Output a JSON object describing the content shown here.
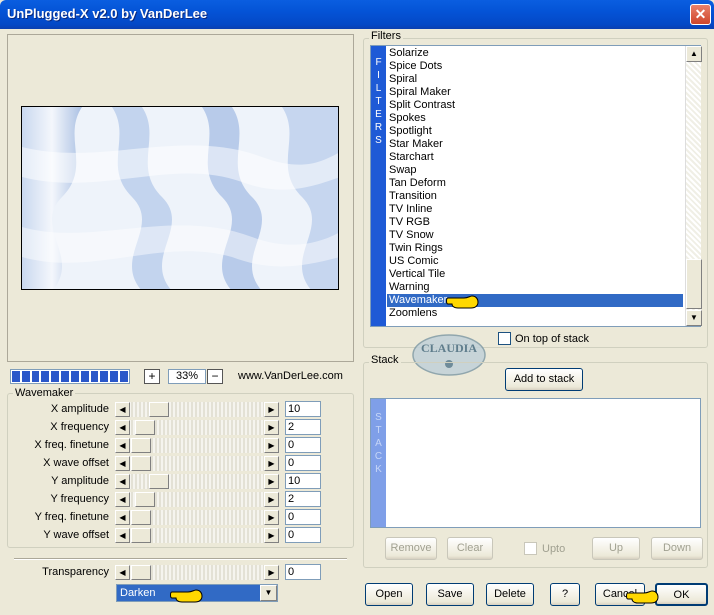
{
  "window": {
    "title": "UnPlugged-X v2.0 by VanDerLee",
    "close_icon": "close-icon"
  },
  "preview": {
    "zoom": "33%",
    "url": "www.VanDerLee.com",
    "progress_segments": 12,
    "plus": "+",
    "minus": "−"
  },
  "wavemaker": {
    "legend": "Wavemaker",
    "params": [
      {
        "label": "X amplitude",
        "value": "10",
        "level": 0.16
      },
      {
        "label": "X frequency",
        "value": "2",
        "level": 0.04
      },
      {
        "label": "X freq. finetune",
        "value": "0",
        "level": 0
      },
      {
        "label": "X wave offset",
        "value": "0",
        "level": 0
      },
      {
        "label": "Y amplitude",
        "value": "10",
        "level": 0.16
      },
      {
        "label": "Y frequency",
        "value": "2",
        "level": 0.04
      },
      {
        "label": "Y freq. finetune",
        "value": "0",
        "level": 0
      },
      {
        "label": "Y wave offset",
        "value": "0",
        "level": 0
      }
    ]
  },
  "transparency": {
    "label": "Transparency",
    "value": "0",
    "level": 0
  },
  "blend": {
    "selected": "Darken"
  },
  "filters": {
    "legend": "Filters",
    "strip": "FILTERS",
    "selected": "Wavemaker",
    "items": [
      "Solarize",
      "Spice Dots",
      "Spiral",
      "Spiral Maker",
      "Split Contrast",
      "Spokes",
      "Spotlight",
      "Star Maker",
      "Starchart",
      "Swap",
      "Tan Deform",
      "Transition",
      "TV Inline",
      "TV RGB",
      "TV Snow",
      "Twin Rings",
      "US Comic",
      "Vertical Tile",
      "Warning",
      "Wavemaker",
      "Zoomlens"
    ],
    "on_top_label": "On top of stack"
  },
  "logo": {
    "text": "CLAUDIA"
  },
  "stack": {
    "legend": "Stack",
    "strip": "STACK",
    "add_label": "Add to stack",
    "remove": "Remove",
    "clear": "Clear",
    "upto": "Upto",
    "up": "Up",
    "down": "Down"
  },
  "footer": {
    "open": "Open",
    "save": "Save",
    "delete": "Delete",
    "help": "?",
    "cancel": "Cancel",
    "ok": "OK"
  },
  "colors": {
    "accent": "#316ac5",
    "titlebar": "#0453d6",
    "filter_strip": "#1e5ad6",
    "stack_strip": "#7f9fe8"
  }
}
